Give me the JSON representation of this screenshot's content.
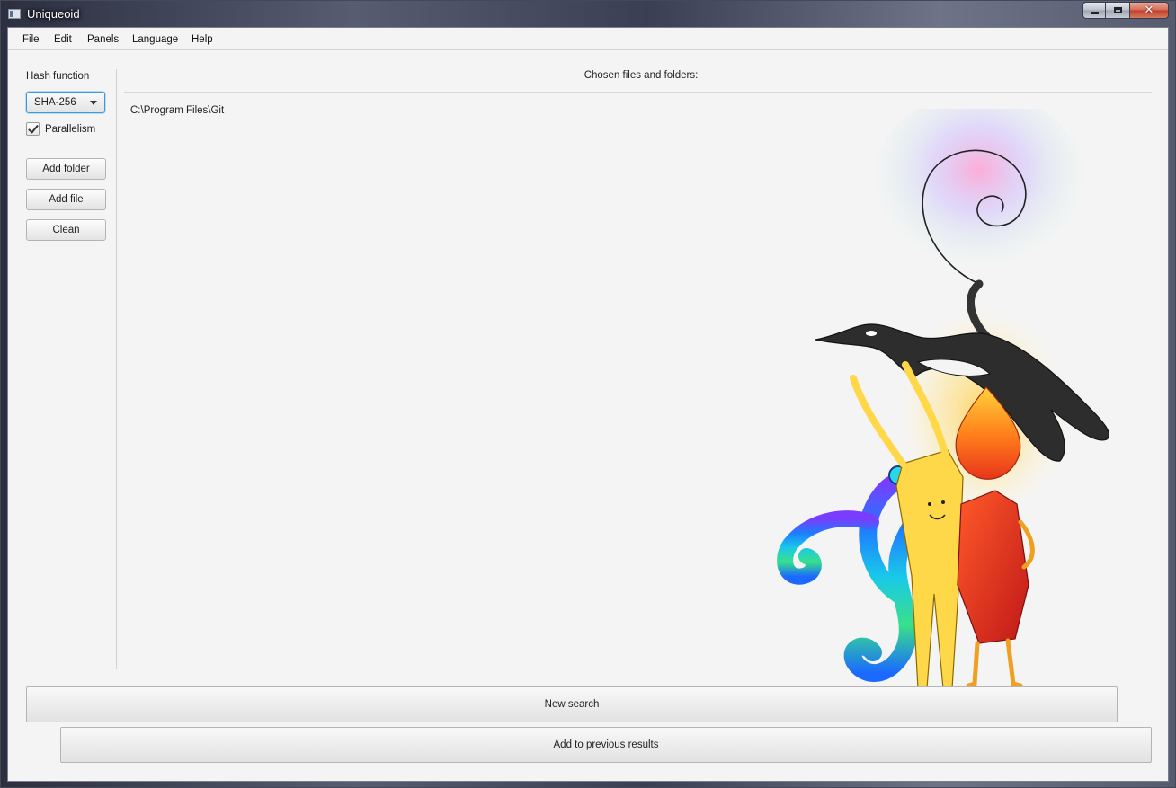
{
  "window": {
    "title": "Uniqueoid"
  },
  "menu": [
    "File",
    "Edit",
    "Panels",
    "Language",
    "Help"
  ],
  "left_panel": {
    "hash_label": "Hash function",
    "hash_selected": "SHA-256",
    "parallelism_label": "Parallelism",
    "parallelism_checked": true,
    "buttons": {
      "add_folder": "Add folder",
      "add_file": "Add file",
      "clean": "Clean"
    }
  },
  "main": {
    "chosen_title": "Chosen files and folders:",
    "items": [
      "C:\\Program Files\\Git"
    ]
  },
  "bottom": {
    "new_search": "New search",
    "add_previous": "Add to previous results"
  }
}
